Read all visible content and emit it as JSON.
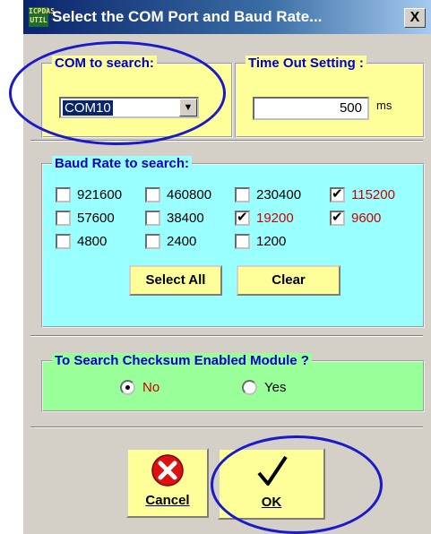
{
  "window": {
    "title": "Select the COM Port and Baud Rate...",
    "icon_text": "ICPDAS UTIL",
    "close_label": "X"
  },
  "com": {
    "label": "COM to search:",
    "value": "COM10",
    "dropdown_glyph": "▼"
  },
  "timeout": {
    "label": "Time Out Setting :",
    "value": "500",
    "unit": "ms"
  },
  "baud": {
    "label": "Baud Rate to search:",
    "rates": [
      {
        "value": "921600",
        "checked": false
      },
      {
        "value": "460800",
        "checked": false
      },
      {
        "value": "230400",
        "checked": false
      },
      {
        "value": "115200",
        "checked": true
      },
      {
        "value": "57600",
        "checked": false
      },
      {
        "value": "38400",
        "checked": false
      },
      {
        "value": "19200",
        "checked": true
      },
      {
        "value": "9600",
        "checked": true
      },
      {
        "value": "4800",
        "checked": false
      },
      {
        "value": "2400",
        "checked": false
      },
      {
        "value": "1200",
        "checked": false
      }
    ],
    "select_all_label": "Select All",
    "clear_label": "Clear"
  },
  "checksum": {
    "label": "To Search Checksum Enabled Module ?",
    "no_label": "No",
    "yes_label": "Yes",
    "selected": "No"
  },
  "buttons": {
    "cancel_label": "Cancel",
    "ok_label": "OK"
  },
  "colors": {
    "title_bar": "#0a246a",
    "yellow_group": "#ffff99",
    "cyan_group": "#99ffff",
    "green_group": "#99ff99",
    "highlight_ellipse": "#1a1acc",
    "checked_text": "#cc0000"
  },
  "icons": {
    "cancel": "red-x-icon",
    "ok": "checkmark-icon"
  }
}
